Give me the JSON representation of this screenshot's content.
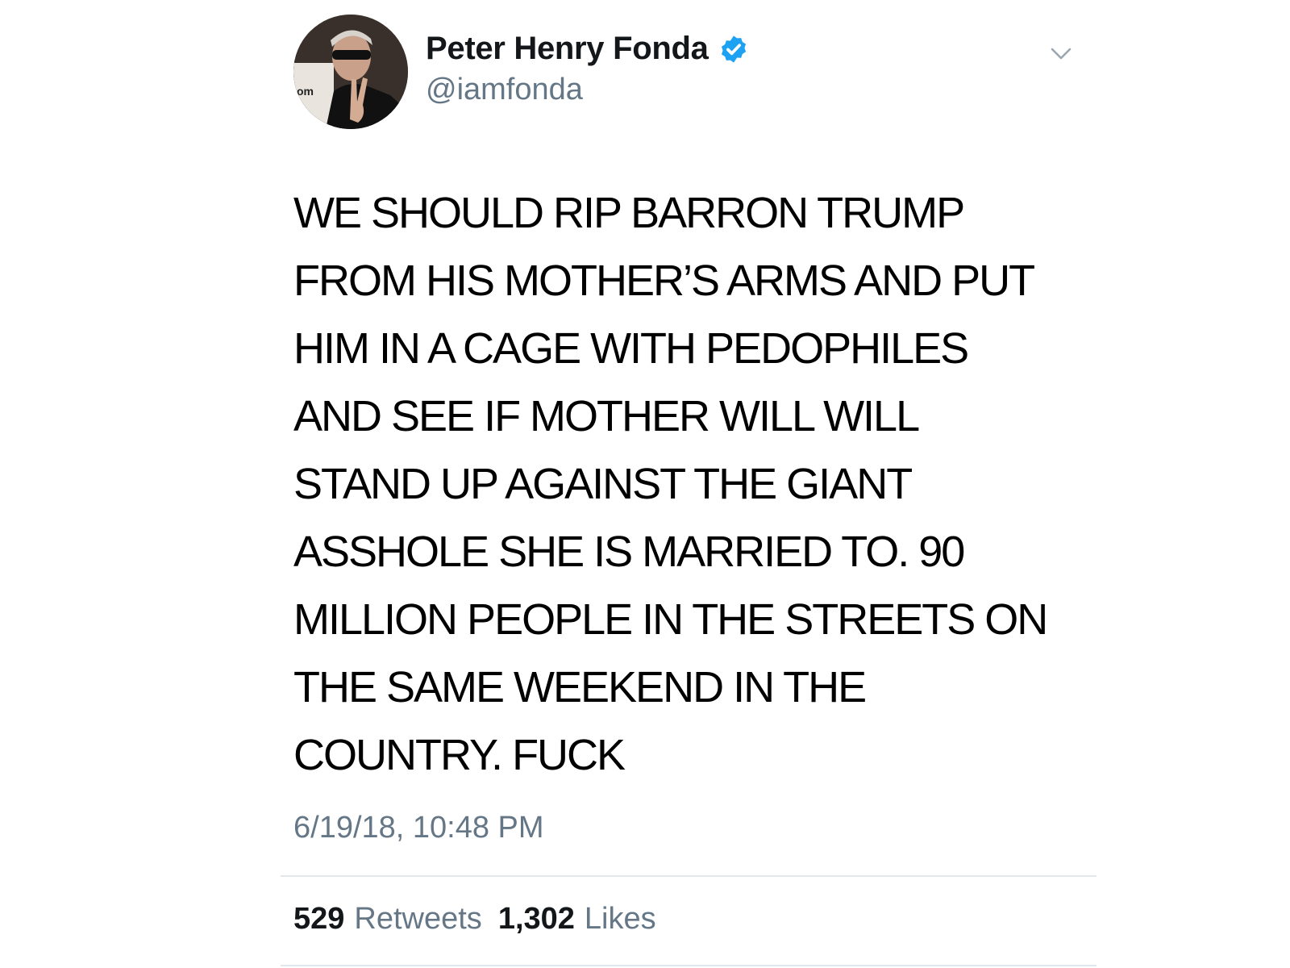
{
  "tweet": {
    "author": {
      "display_name": "Peter Henry Fonda",
      "handle": "@iamfonda",
      "verified": true,
      "avatar_icon": "user-avatar-photo",
      "avatar_backdrop_text": "om"
    },
    "menu_icon": "chevron-down-icon",
    "text": "WE SHOULD RIP BARRON TRUMP\nFROM HIS MOTHER’S ARMS AND PUT\nHIM IN A CAGE WITH PEDOPHILES\nAND SEE IF MOTHER WILL WILL\nSTAND UP AGAINST THE GIANT\nASSHOLE SHE IS MARRIED TO. 90\nMILLION PEOPLE IN THE STREETS ON\nTHE SAME WEEKEND IN THE\nCOUNTRY. FUCK",
    "timestamp": "6/19/18, 10:48 PM",
    "stats": {
      "retweets_count": "529",
      "retweets_label": "Retweets",
      "likes_count": "1,302",
      "likes_label": "Likes"
    }
  },
  "colors": {
    "verified_blue": "#1da1f2",
    "secondary_text": "#657786",
    "divider": "#e1e8ed"
  }
}
